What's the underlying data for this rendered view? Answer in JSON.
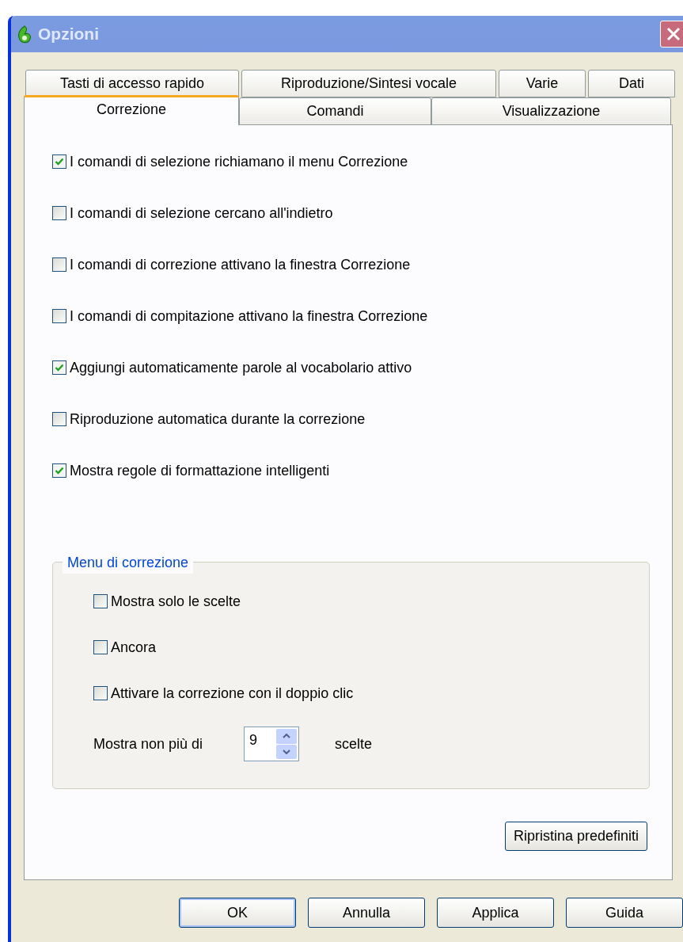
{
  "window": {
    "title": "Opzioni"
  },
  "tab_rows": [
    [
      {
        "label": "Tasti di accesso rapido",
        "selected": false
      },
      {
        "label": "Riproduzione/Sintesi vocale",
        "selected": false
      },
      {
        "label": "Varie",
        "selected": false
      },
      {
        "label": "Dati",
        "selected": false
      }
    ],
    [
      {
        "label": "Correzione",
        "selected": true
      },
      {
        "label": "Comandi",
        "selected": false
      },
      {
        "label": "Visualizzazione",
        "selected": false
      }
    ]
  ],
  "options": [
    {
      "label": "I comandi di selezione richiamano il menu Correzione",
      "checked": true
    },
    {
      "label": "I comandi di selezione cercano all'indietro",
      "checked": false
    },
    {
      "label": "I comandi di correzione attivano la finestra Correzione",
      "checked": false
    },
    {
      "label": "I comandi di compitazione attivano la finestra Correzione",
      "checked": false
    },
    {
      "label": "Aggiungi automaticamente parole al vocabolario attivo",
      "checked": true
    },
    {
      "label": "Riproduzione automatica durante la correzione",
      "checked": false
    },
    {
      "label": "Mostra regole di formattazione intelligenti",
      "checked": true
    }
  ],
  "correction_menu": {
    "title": "Menu di correzione",
    "options": [
      {
        "label": "Mostra solo le scelte",
        "checked": false
      },
      {
        "label": "Ancora",
        "checked": false
      },
      {
        "label": "Attivare la correzione con il doppio clic",
        "checked": false
      }
    ],
    "max_choices": {
      "label": "Mostra non più di",
      "value": "9",
      "suffix": "scelte"
    }
  },
  "restore_button": "Ripristina predefiniti",
  "buttons": [
    "OK",
    "Annulla",
    "Applica",
    "Guida"
  ]
}
